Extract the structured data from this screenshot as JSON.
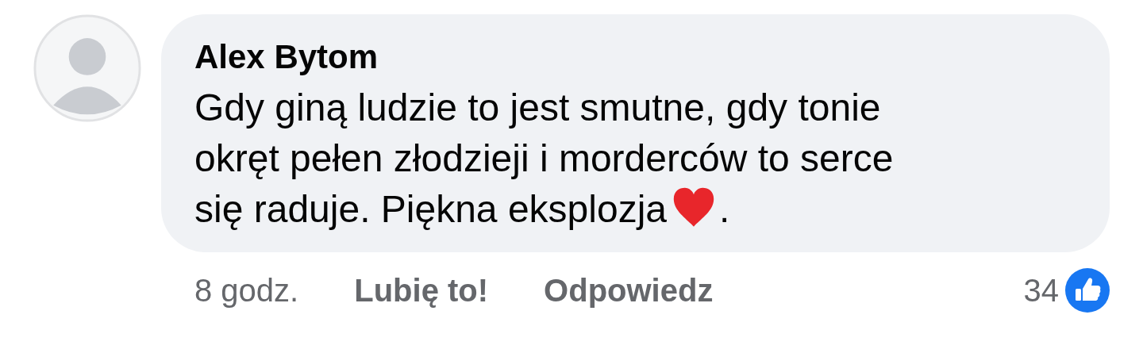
{
  "comment": {
    "author": "Alex Bytom",
    "lines": [
      "Gdy giną ludzie to jest smutne, gdy tonie",
      "okręt pełen złodzieji i morderców to serce",
      "się raduje. Piękna eksplozja"
    ],
    "text_end": "."
  },
  "actions": [
    {
      "kind": "time",
      "label": "8 godz."
    },
    {
      "kind": "link",
      "label": "Lubię to!"
    },
    {
      "kind": "link",
      "label": "Odpowiedz"
    }
  ],
  "reactions": {
    "count": "34"
  }
}
